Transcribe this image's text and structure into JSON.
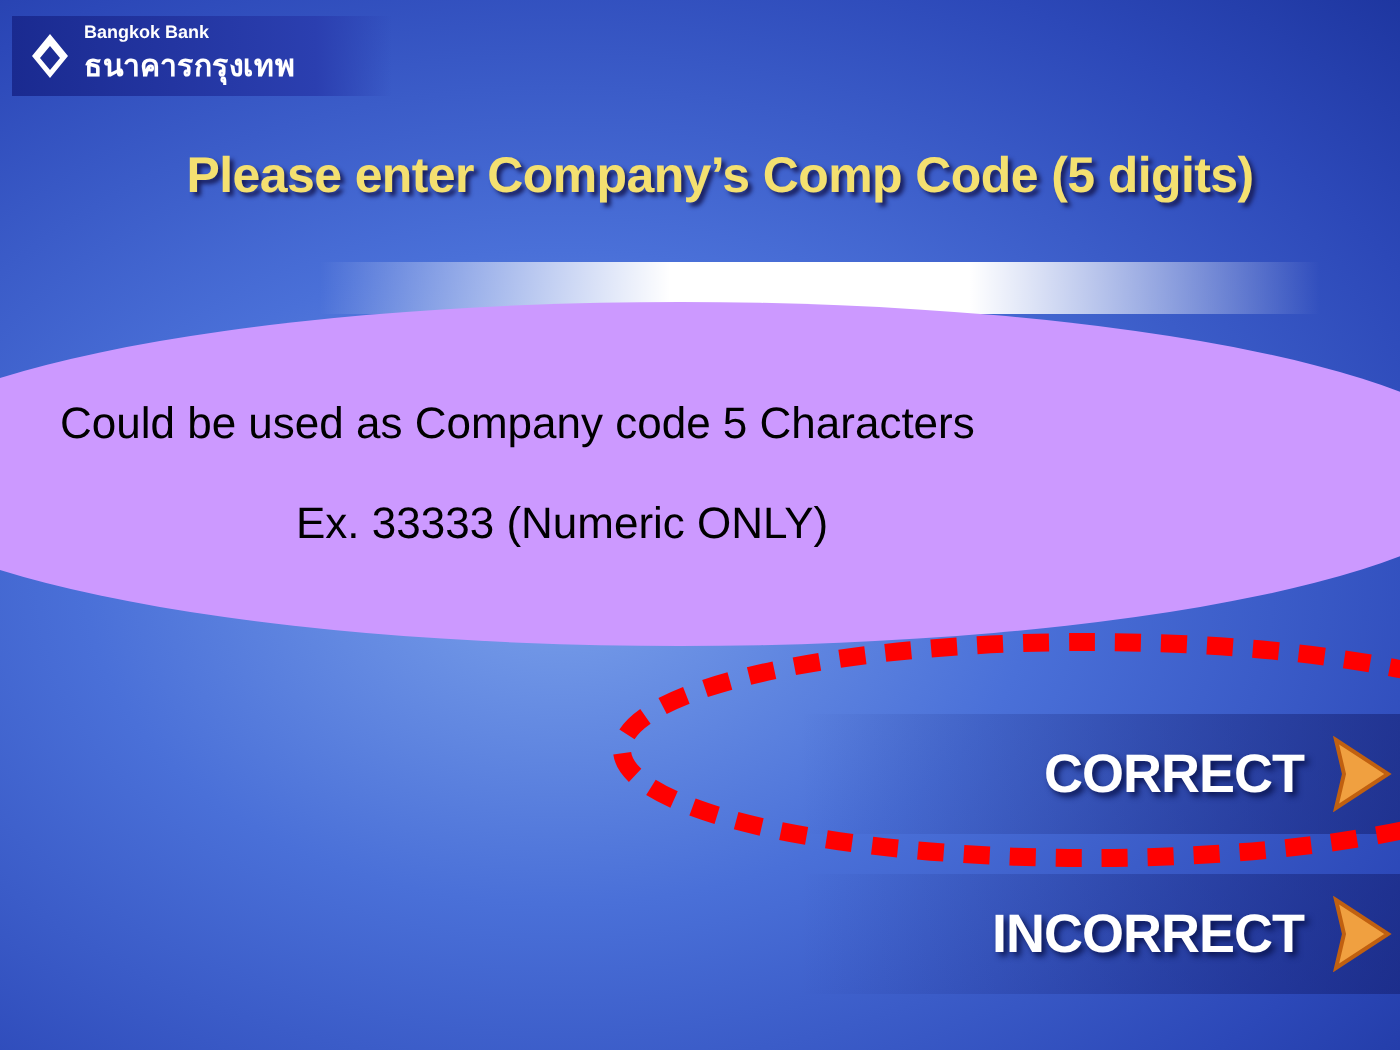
{
  "logo": {
    "name": "Bangkok Bank",
    "name_thai": "ธนาคารกรุงเทพ"
  },
  "prompt": "Please enter Company’s Comp Code (5 digits)",
  "callout": {
    "lines": [
      "Could be used as Company code 5 Characters",
      "Ex. 33333 (Numeric ONLY)"
    ]
  },
  "options": [
    {
      "label": "CORRECT",
      "highlighted": true
    },
    {
      "label": "INCORRECT",
      "highlighted": false
    }
  ]
}
